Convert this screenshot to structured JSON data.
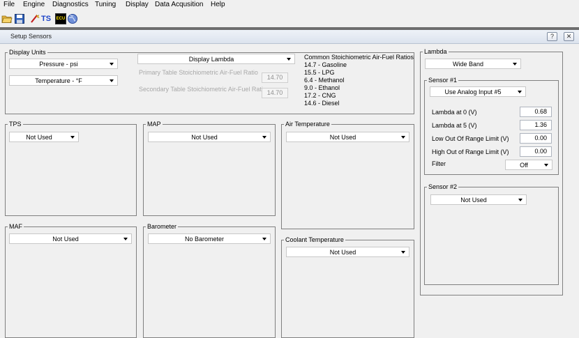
{
  "menu": [
    "File",
    "Engine",
    "Diagnostics",
    "Tuning",
    "Display",
    "Data Acqusition",
    "Help"
  ],
  "toolbar": {
    "ts_label": "TS",
    "ecu_label": "ECU"
  },
  "window": {
    "title": "Setup Sensors",
    "help_label": "?",
    "close_label": "✕"
  },
  "display_units": {
    "title": "Display Units",
    "pressure": "Pressure - psi",
    "temperature": "Temperature - °F",
    "lambda_mode": "Display Lambda",
    "primary_label": "Primary Table Stoichiometric Air-Fuel Ratio",
    "primary_value": "14.70",
    "secondary_label": "Secondary Table Stoichiometric Air-Fuel Ratio",
    "secondary_value": "14.70",
    "ratios_title": "Common Stoichiometric Air-Fuel Ratios",
    "ratios": [
      "14.7 - Gasoline",
      "15.5 - LPG",
      "6.4 - Methanol",
      "9.0 - Ethanol",
      "17.2 - CNG",
      "14.6 - Diesel"
    ]
  },
  "tps": {
    "title": "TPS",
    "value": "Not Used"
  },
  "map": {
    "title": "MAP",
    "value": "Not Used"
  },
  "air_temp": {
    "title": "Air Temperature",
    "value": "Not Used"
  },
  "maf": {
    "title": "MAF",
    "value": "Not Used"
  },
  "barometer": {
    "title": "Barometer",
    "value": "No Barometer"
  },
  "coolant": {
    "title": "Coolant Temperature",
    "value": "Not Used"
  },
  "lambda": {
    "title": "Lambda",
    "type": "Wide Band",
    "sensor1": {
      "title": "Sensor #1",
      "input": "Use Analog Input #5",
      "at0_label": "Lambda at 0 (V)",
      "at0_value": "0.68",
      "at5_label": "Lambda at 5 (V)",
      "at5_value": "1.36",
      "low_label": "Low Out Of Range Limit (V)",
      "low_value": "0.00",
      "high_label": "High Out of Range Limit (V)",
      "high_value": "0.00",
      "filter_label": "Filter",
      "filter_value": "Off"
    },
    "sensor2": {
      "title": "Sensor #2",
      "input": "Not Used"
    }
  }
}
